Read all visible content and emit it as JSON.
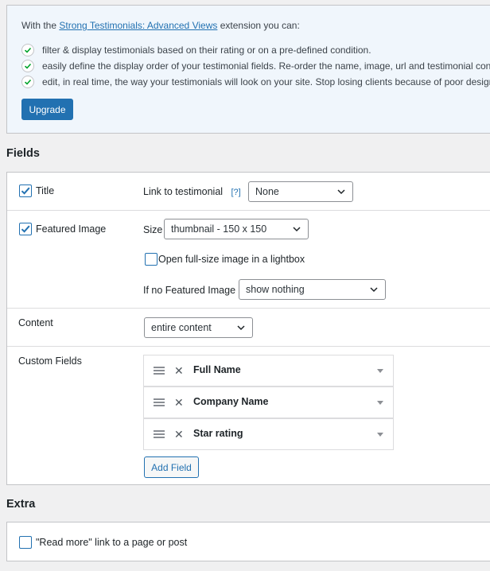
{
  "promo": {
    "intro_prefix": "With the ",
    "intro_link": "Strong Testimonials: Advanced Views",
    "intro_suffix": " extension you can:",
    "features": [
      "filter & display testimonials based on their rating or on a pre-defined condition.",
      "easily define the display order of your testimonial fields. Re-order the name, image, url and testimonial content",
      "edit, in real time, the way your testimonials will look on your site. Stop losing clients because of poor design."
    ],
    "upgrade_label": "Upgrade"
  },
  "fields": {
    "section_title": "Fields",
    "title_row": {
      "checkbox_label": "Title",
      "checked": true,
      "link_label": "Link to testimonial",
      "help_label": "[?]",
      "link_value": "None"
    },
    "image_row": {
      "checkbox_label": "Featured Image",
      "checked": true,
      "size_label": "Size",
      "size_value": "thumbnail - 150 x 150",
      "lightbox_label": "Open full-size image in a lightbox",
      "lightbox_checked": false,
      "no_image_label": "If no Featured Image",
      "no_image_value": "show nothing"
    },
    "content_row": {
      "label": "Content",
      "value": "entire content"
    },
    "custom_row": {
      "label": "Custom Fields",
      "items": [
        "Full Name",
        "Company Name",
        "Star rating"
      ],
      "add_label": "Add Field"
    }
  },
  "extra": {
    "section_title": "Extra",
    "read_more_label": "\"Read more\" link to a page or post",
    "read_more_checked": false
  },
  "colors": {
    "accent": "#2271b1",
    "page_bg": "#f0f0f1",
    "promo_bg": "#f0f6fc",
    "check_green": "#00a32a"
  }
}
